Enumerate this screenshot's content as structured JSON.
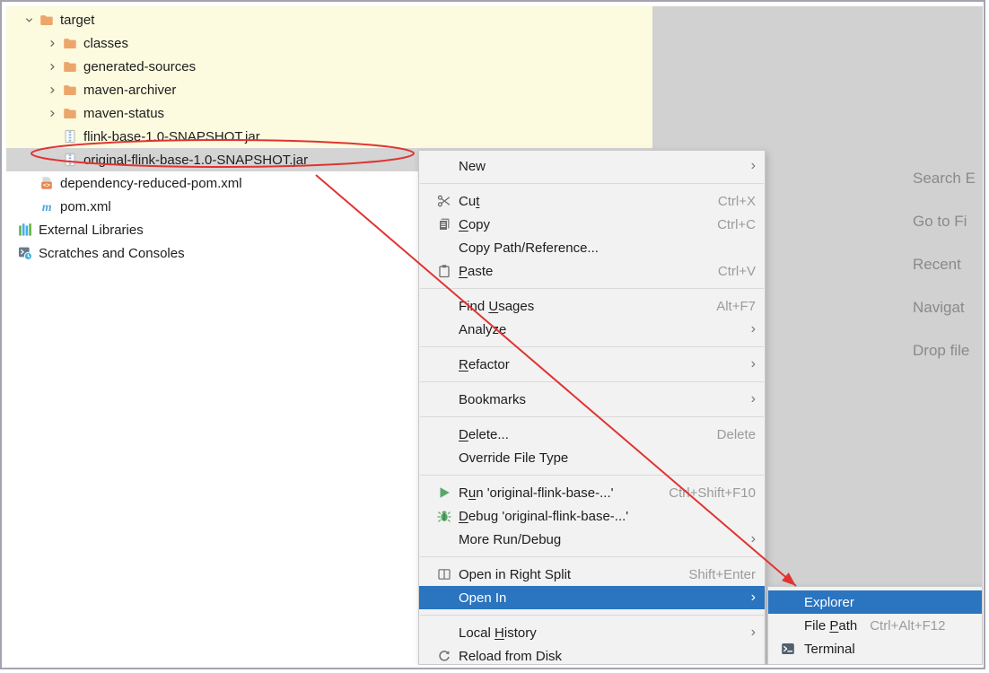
{
  "colors": {
    "frame_border": "#a4a4b0",
    "highlight_yellow": "#fcfbdf",
    "selection_gray": "#d4d4d4",
    "editor_bg": "#d1d1d1",
    "menu_bg": "#f2f2f2",
    "menu_border": "#c9c9c9",
    "menu_separator": "#d9d9d9",
    "selection_blue": "#2a74c0",
    "annotation_red": "#e03432",
    "shortcut_gray": "#9b9b9b",
    "hint_gray": "#8a8a8a",
    "run_green": "#59A869"
  },
  "project_tree": {
    "items": [
      {
        "label": "target",
        "icon": "folder-icon",
        "chevron": "down",
        "level": 0,
        "chevron_slot": true,
        "highlighted": true
      },
      {
        "label": "classes",
        "icon": "folder-icon",
        "chevron": "right",
        "level": 1,
        "chevron_slot": true,
        "highlighted": true
      },
      {
        "label": "generated-sources",
        "icon": "folder-icon",
        "chevron": "right",
        "level": 1,
        "chevron_slot": true,
        "highlighted": true
      },
      {
        "label": "maven-archiver",
        "icon": "folder-icon",
        "chevron": "right",
        "level": 1,
        "chevron_slot": true,
        "highlighted": true
      },
      {
        "label": "maven-status",
        "icon": "folder-icon",
        "chevron": "right",
        "level": 1,
        "chevron_slot": true,
        "highlighted": true
      },
      {
        "label": "flink-base-1.0-SNAPSHOT.jar",
        "icon": "jar-icon",
        "chevron": null,
        "level": 1,
        "chevron_slot": true,
        "highlighted": true
      },
      {
        "label": "original-flink-base-1.0-SNAPSHOT.jar",
        "icon": "jar-icon",
        "chevron": null,
        "level": 1,
        "chevron_slot": true,
        "selected": true
      },
      {
        "label": "dependency-reduced-pom.xml",
        "icon": "xml-file-icon",
        "chevron": null,
        "level": 0,
        "chevron_slot": true
      },
      {
        "label": "pom.xml",
        "icon": "maven-icon",
        "chevron": null,
        "level": 0,
        "chevron_slot": true
      },
      {
        "label": "External Libraries",
        "icon": "external-libraries-icon",
        "chevron": null,
        "level": 0,
        "chevron_slot": false
      },
      {
        "label": "Scratches and Consoles",
        "icon": "scratches-icon",
        "chevron": null,
        "level": 0,
        "chevron_slot": false
      }
    ]
  },
  "editor_hints": [
    "Search E",
    "Go to Fi",
    "Recent",
    "Navigat",
    "Drop file"
  ],
  "context_menu": {
    "items": [
      {
        "label": "New",
        "arrow": true
      },
      {
        "separator": true
      },
      {
        "label": "Cut",
        "icon": "cut-icon",
        "shortcut": "Ctrl+X",
        "mnemonic": 2
      },
      {
        "label": "Copy",
        "icon": "copy-icon",
        "shortcut": "Ctrl+C",
        "mnemonic": 0
      },
      {
        "label": "Copy Path/Reference..."
      },
      {
        "label": "Paste",
        "icon": "paste-icon",
        "shortcut": "Ctrl+V",
        "mnemonic": 0
      },
      {
        "separator": true
      },
      {
        "label": "Find Usages",
        "shortcut": "Alt+F7",
        "mnemonic": 5
      },
      {
        "label": "Analyze",
        "arrow": true
      },
      {
        "separator": true
      },
      {
        "label": "Refactor",
        "arrow": true,
        "mnemonic": 0
      },
      {
        "separator": true
      },
      {
        "label": "Bookmarks",
        "arrow": true
      },
      {
        "separator": true
      },
      {
        "label": "Delete...",
        "shortcut": "Delete",
        "mnemonic": 0
      },
      {
        "label": "Override File Type"
      },
      {
        "separator": true
      },
      {
        "label": "Run 'original-flink-base-...'",
        "icon": "run-icon",
        "shortcut": "Ctrl+Shift+F10",
        "mnemonic": 1
      },
      {
        "label": "Debug 'original-flink-base-...'",
        "icon": "debug-icon",
        "mnemonic": 0
      },
      {
        "label": "More Run/Debug",
        "arrow": true
      },
      {
        "separator": true
      },
      {
        "label": "Open in Right Split",
        "icon": "split-icon",
        "shortcut": "Shift+Enter"
      },
      {
        "label": "Open In",
        "arrow": true,
        "selected": true
      },
      {
        "separator": true
      },
      {
        "label": "Local History",
        "arrow": true,
        "mnemonic": 6
      },
      {
        "label": "Reload from Disk",
        "icon": "reload-icon"
      }
    ]
  },
  "open_in_submenu": {
    "items": [
      {
        "label": "Explorer",
        "selected": true
      },
      {
        "label": "File Path",
        "shortcut": "Ctrl+Alt+F12",
        "mnemonic": 5
      },
      {
        "label": "Terminal",
        "icon": "terminal-icon"
      }
    ]
  },
  "annotations": {
    "circled_item": "original-flink-base-1.0-SNAPSHOT.jar",
    "arrow_points_to": "Explorer",
    "color": "#e03432"
  }
}
